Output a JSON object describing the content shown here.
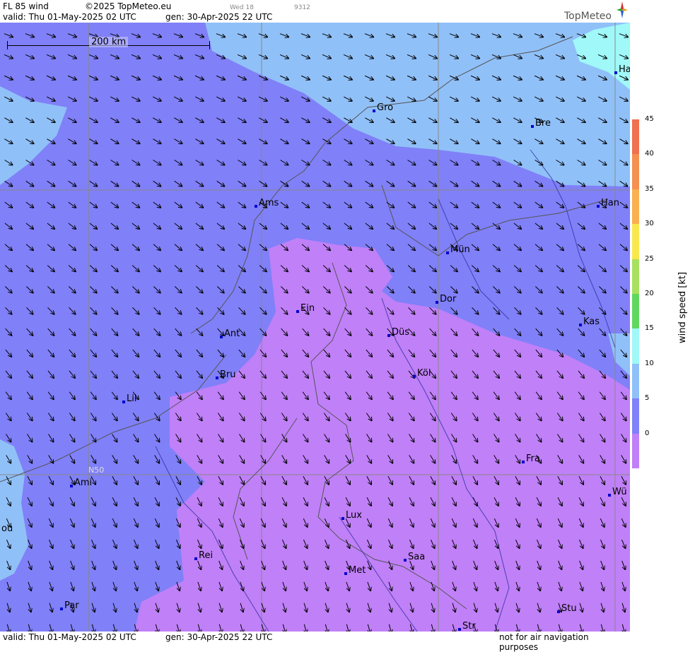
{
  "header": {
    "product": "FL 85 wind",
    "copyright": "©2025 TopMeteo.eu",
    "valid": "valid:  Thu  01-May-2025  02 UTC",
    "gen": "gen: 30-Apr-2025 22 UTC",
    "run_day": "Wed 18",
    "code": "9312"
  },
  "logo": {
    "text": "TopMeteo"
  },
  "scale": {
    "label": "200 km"
  },
  "grid_label": "N50",
  "cities": [
    {
      "name": "Ha"
    },
    {
      "name": "Gro"
    },
    {
      "name": "Bre"
    },
    {
      "name": "Ams"
    },
    {
      "name": "Han"
    },
    {
      "name": "Mün"
    },
    {
      "name": "Dor"
    },
    {
      "name": "Ein"
    },
    {
      "name": "Düs"
    },
    {
      "name": "Kas"
    },
    {
      "name": "Ant"
    },
    {
      "name": "Köl"
    },
    {
      "name": "Bru"
    },
    {
      "name": "Lil"
    },
    {
      "name": "Fra"
    },
    {
      "name": "Ami"
    },
    {
      "name": "Wü"
    },
    {
      "name": "Lux"
    },
    {
      "name": "ou"
    },
    {
      "name": "Rei"
    },
    {
      "name": "Saa"
    },
    {
      "name": "Met"
    },
    {
      "name": "Par"
    },
    {
      "name": "Stu"
    },
    {
      "name": "Str"
    }
  ],
  "legend": {
    "label": "wind  speed  [kt]",
    "ticks": [
      "45",
      "40",
      "35",
      "30",
      "25",
      "20",
      "15",
      "10",
      "5",
      "0"
    ],
    "colors": [
      "#f07050",
      "#f49050",
      "#f8b050",
      "#f8e850",
      "#a8e060",
      "#60d860",
      "#a0f8f8",
      "#90c0f8",
      "#8080f8",
      "#c080f8"
    ]
  },
  "footer": {
    "valid": "valid:  Thu  01-May-2025  02 UTC",
    "gen": "gen: 30-Apr-2025 22 UTC",
    "note": "not for air navigation purposes"
  }
}
